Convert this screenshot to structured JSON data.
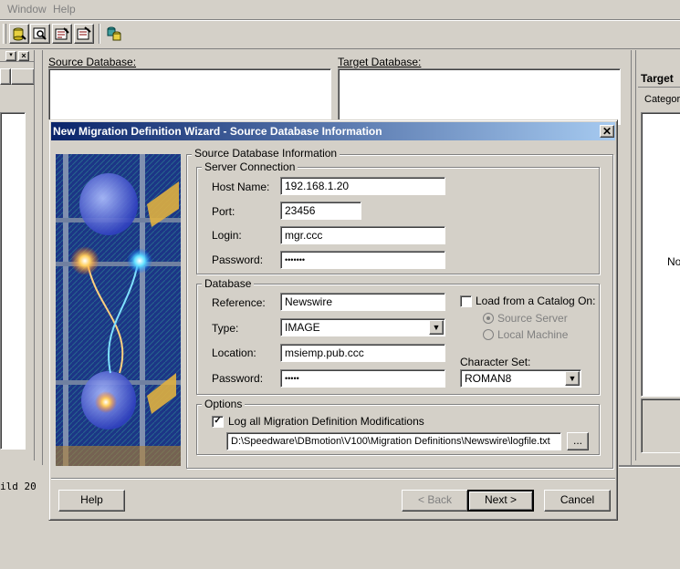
{
  "menu": {
    "items": [
      {
        "label": "Window"
      },
      {
        "label": "Help"
      }
    ]
  },
  "toolbar": {
    "icons": [
      {
        "name": "connect-database-icon"
      },
      {
        "name": "search-icon"
      },
      {
        "name": "edit-definition-icon"
      },
      {
        "name": "properties-icon"
      },
      {
        "name": "database-group-icon"
      }
    ]
  },
  "background": {
    "source_label": "Source Database:",
    "target_label": "Target Database:",
    "right_header": "Target",
    "right_tab": "Categorie",
    "right_text": "No",
    "status_text": "ild 20"
  },
  "dialog": {
    "title": "New Migration Definition Wizard - Source Database Information",
    "main_group": "Source Database Information",
    "server_connection": {
      "title": "Server Connection",
      "host_label": "Host Name:",
      "host_value": "192.168.1.20",
      "port_label": "Port:",
      "port_value": "23456",
      "login_label": "Login:",
      "login_value": "mgr.ccc",
      "password_label": "Password:",
      "password_value": "•••••••"
    },
    "database": {
      "title": "Database",
      "reference_label": "Reference:",
      "reference_value": "Newswire",
      "type_label": "Type:",
      "type_value": "IMAGE",
      "location_label": "Location:",
      "location_value": "msiemp.pub.ccc",
      "password_label": "Password:",
      "password_value": "•••••",
      "catalog_label": "Load from a Catalog On:",
      "source_server_label": "Source Server",
      "local_machine_label": "Local Machine",
      "charset_label": "Character Set:",
      "charset_value": "ROMAN8"
    },
    "options": {
      "title": "Options",
      "log_label": "Log all Migration Definition Modifications",
      "log_checked": true,
      "logfile_value": "D:\\Speedware\\DBmotion\\V100\\Migration Definitions\\Newswire\\logfile.txt",
      "browse_label": "..."
    },
    "buttons": {
      "help": "Help",
      "back": "< Back",
      "next": "Next >",
      "cancel": "Cancel"
    }
  }
}
